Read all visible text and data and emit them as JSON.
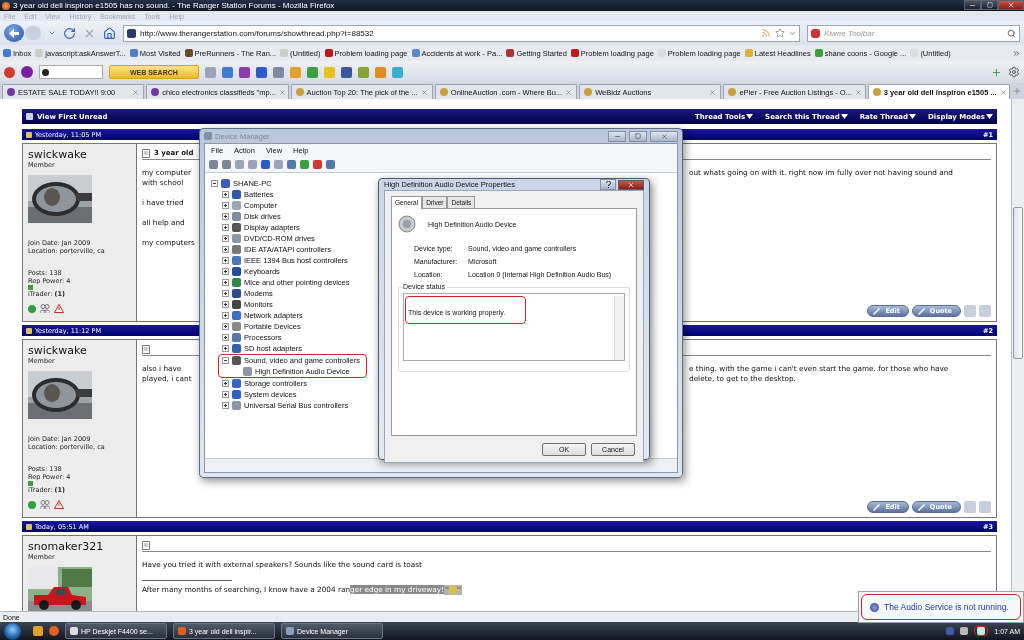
{
  "browser": {
    "title": "3 year old dell inspiron e1505 has no sound. - The Ranger Station Forums - Mozilla Firefox",
    "menu": [
      "File",
      "Edit",
      "View",
      "History",
      "Bookmarks",
      "Tools",
      "Help"
    ],
    "url": "http://www.therangerstation.com/forums/showthread.php?t=88532",
    "search": {
      "placeholder": "Kiwee Toolbar"
    },
    "bookmarks": [
      "Inbox",
      "javascript:askAnswerT...",
      "Most Visited",
      "PreRunners - The Ran...",
      "(Untitled)",
      "Problem loading page",
      "Accidents at work - Pa...",
      "Getting Started",
      "Problem loading page",
      "Problem loading page",
      "Latest Headlines",
      "shane coons - Google ...",
      "(Untitled)"
    ],
    "toolbar": {
      "search_button": "WEB SEARCH"
    },
    "tabs": [
      {
        "label": "ESTATE SALE TODAY!! 9:00",
        "selected": false
      },
      {
        "label": "chico electronics classifieds \"mp...",
        "selected": false
      },
      {
        "label": "Auction Top 20: The pick of the ...",
        "selected": false
      },
      {
        "label": "OnlineAuction .com - Where Bu...",
        "selected": false
      },
      {
        "label": "WeBidz Auctions",
        "selected": false
      },
      {
        "label": "ePier - Free Auction Listings - O...",
        "selected": false
      },
      {
        "label": "3 year old dell inspiron e1505 ...",
        "selected": true
      }
    ],
    "status": "Done"
  },
  "forum": {
    "view_first_unread": "View First Unread",
    "thread_menu": [
      "Thread Tools",
      "Search this Thread",
      "Rate Thread",
      "Display Modes"
    ],
    "posts": [
      {
        "date": "Yesterday, 11:05 PM",
        "number": "#1",
        "user": "swickwake",
        "rank": "Member",
        "avatar": {
          "kind": "picture"
        },
        "details": [
          "Join Date: Jan 2009",
          "Location: porterville, ca"
        ],
        "stats": [
          "Posts: 138",
          "Rep Power: 4",
          "iTrader: **(1)**"
        ],
        "title": "3 year old",
        "paragraphs": [
          [
            {
              "left": "my computer",
              "right": "out whats going on with it. right now im fully over not having sound and"
            },
            {
              "left": "with school"
            }
          ],
          [
            {
              "left": "i have tried"
            }
          ],
          [
            {
              "left": "all help and"
            }
          ],
          [
            {
              "left": "my computers"
            }
          ]
        ],
        "buttons": [
          "Edit",
          "Quote"
        ]
      },
      {
        "date": "Yesterday, 11:12 PM",
        "number": "#2",
        "user": "swickwake",
        "rank": "Member",
        "avatar": {
          "kind": "picture"
        },
        "details": [
          "Join Date: Jan 2009",
          "Location: porterville, ca"
        ],
        "stats": [
          "Posts: 138",
          "Rep Power: 4",
          "iTrader: **(1)**"
        ],
        "paragraphs": [
          [
            {
              "left": "also i have",
              "right": "e thing. with the game i can't even start the game. for those who have"
            },
            {
              "left": "played, i cant",
              "right": "delete, to get to the desktop."
            }
          ]
        ],
        "buttons": [
          "Edit",
          "Quote"
        ]
      },
      {
        "date": "Today, 05:51 AM",
        "number": "#3",
        "user": "snomaker321",
        "rank": "Member",
        "avatar": {
          "kind": "picture"
        },
        "paragraphs": [
          [
            {
              "left": "Have you tried it with external speakers? Sounds like the sound card is toast"
            }
          ]
        ],
        "signature": {
          "text": "After many months of searching, I know have a 2004 ran",
          "selected_text": "ger edge in my driveway!"
        }
      }
    ]
  },
  "device_manager": {
    "title": "Device Manager",
    "menu": [
      "File",
      "Action",
      "View",
      "Help"
    ],
    "tree": {
      "label": "SHANE-PC",
      "expanded": true,
      "children": [
        {
          "label": "Batteries",
          "expanded": false,
          "highlighted": false
        },
        {
          "label": "Computer",
          "expanded": false,
          "highlighted": false
        },
        {
          "label": "Disk drives",
          "expanded": false,
          "highlighted": false
        },
        {
          "label": "Display adapters",
          "expanded": false,
          "highlighted": false
        },
        {
          "label": "DVD/CD-ROM drives",
          "expanded": false,
          "highlighted": false
        },
        {
          "label": "IDE ATA/ATAPI controllers",
          "expanded": false,
          "highlighted": false
        },
        {
          "label": "IEEE 1394 Bus host controllers",
          "expanded": false,
          "highlighted": false
        },
        {
          "label": "Keyboards",
          "expanded": false,
          "highlighted": false
        },
        {
          "label": "Mice and other pointing devices",
          "expanded": false,
          "highlighted": false
        },
        {
          "label": "Modems",
          "expanded": false,
          "highlighted": false
        },
        {
          "label": "Monitors",
          "expanded": false,
          "highlighted": false
        },
        {
          "label": "Network adapters",
          "expanded": false,
          "highlighted": false
        },
        {
          "label": "Portable Devices",
          "expanded": false,
          "highlighted": false
        },
        {
          "label": "Processors",
          "expanded": false,
          "highlighted": false
        },
        {
          "label": "SD host adapters",
          "expanded": false,
          "highlighted": false
        },
        {
          "label": "Sound, video and game controllers",
          "expanded": true,
          "highlighted": true,
          "children": [
            {
              "label": "High Definition Audio Device"
            }
          ]
        },
        {
          "label": "Storage controllers",
          "expanded": false,
          "highlighted": false
        },
        {
          "label": "System devices",
          "expanded": false,
          "highlighted": false
        },
        {
          "label": "Universal Serial Bus controllers",
          "expanded": false,
          "highlighted": false
        }
      ]
    }
  },
  "dialog": {
    "title": "High Definition Audio Device Properties",
    "tabs": [
      {
        "label": "General",
        "selected": true
      },
      {
        "label": "Driver",
        "selected": false
      },
      {
        "label": "Details",
        "selected": false
      }
    ],
    "device_name": "High Definition Audio Device",
    "properties": [
      {
        "label": "Device type:",
        "value": "Sound, video and game controllers"
      },
      {
        "label": "Manufacturer:",
        "value": "Microsoft"
      },
      {
        "label": "Location:",
        "value": "Location 0 (Internal High Definition Audio Bus)"
      }
    ],
    "status_group": "Device status",
    "status_text": "This device is working properly.",
    "status_highlighted": true,
    "buttons": [
      "OK",
      "Cancel"
    ]
  },
  "taskbar": {
    "items": [
      "HP Deskjet F4400 se...",
      "3 year old dell inspir...",
      "Device Manager"
    ],
    "volume_highlighted": true,
    "clock": "1:07 AM"
  },
  "notification": {
    "text": "The Audio Service is not running.",
    "highlighted": true
  }
}
